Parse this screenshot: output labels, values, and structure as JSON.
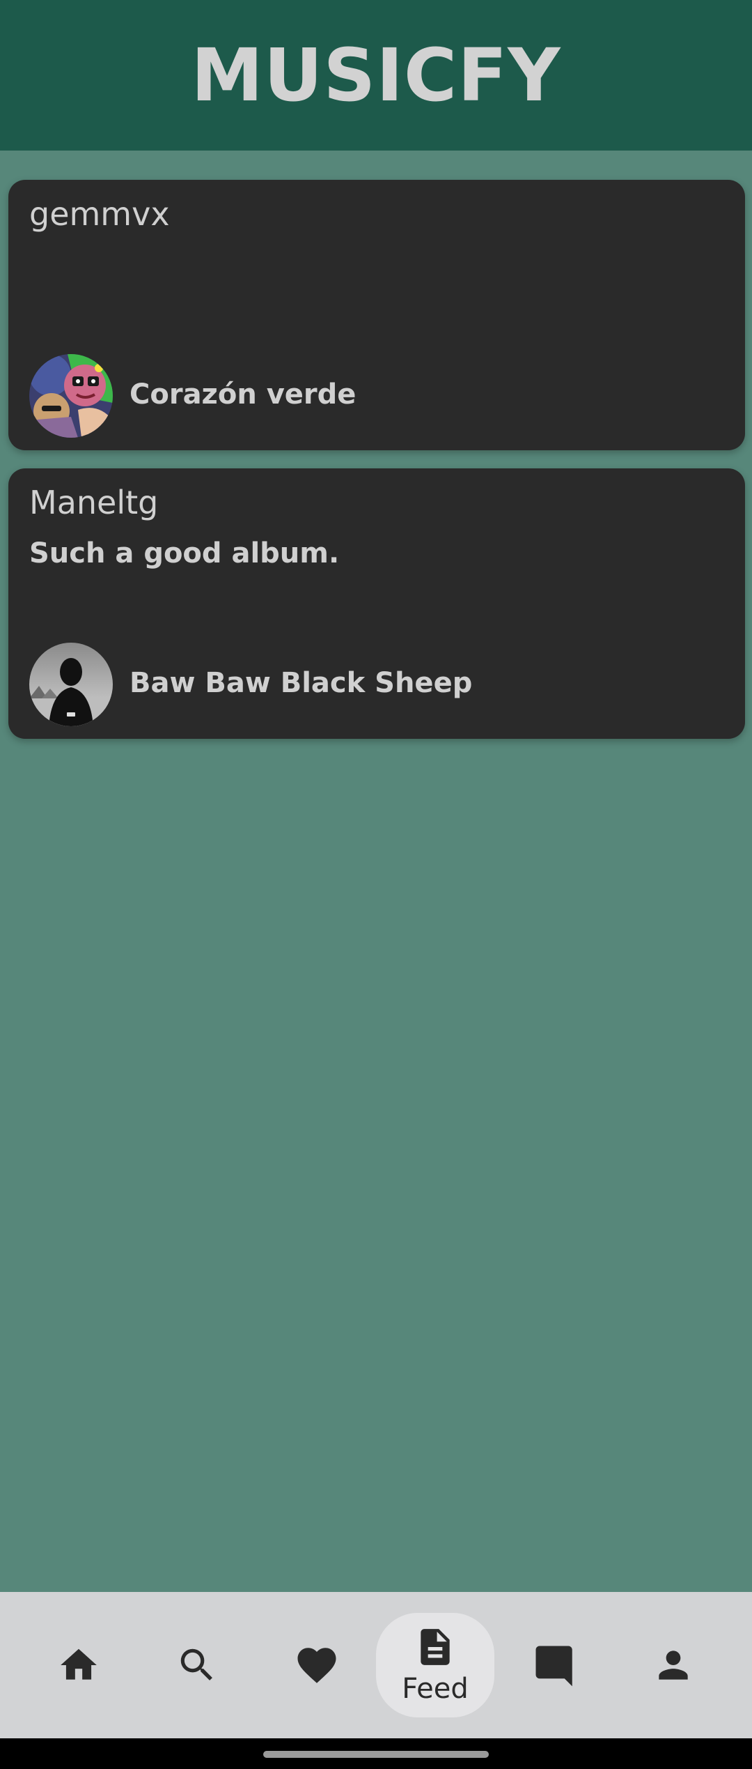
{
  "app": {
    "title": "MUSICFY"
  },
  "colors": {
    "header": "#1d5a4b",
    "background": "#57877a",
    "card": "#2a2a2a",
    "text": "#d0d0d0",
    "nav_bar": "#d2d3d5",
    "nav_active": "#e4e4e6"
  },
  "feed": {
    "posts": [
      {
        "user": "gemmvx",
        "comment": "",
        "album_title": "Corazón verde",
        "cover_icon": "colorful-illustrated-album-cover"
      },
      {
        "user": "Maneltg",
        "comment": "Such a good album.",
        "album_title": "Baw Baw Black Sheep",
        "cover_icon": "monochrome-silhouette-album-cover"
      }
    ]
  },
  "bottom_nav": {
    "items": [
      {
        "icon": "home-icon",
        "label": "",
        "active": false
      },
      {
        "icon": "search-icon",
        "label": "",
        "active": false
      },
      {
        "icon": "heart-icon",
        "label": "",
        "active": false
      },
      {
        "icon": "feed-icon",
        "label": "Feed",
        "active": true
      },
      {
        "icon": "chat-icon",
        "label": "",
        "active": false
      },
      {
        "icon": "profile-icon",
        "label": "",
        "active": false
      }
    ]
  }
}
